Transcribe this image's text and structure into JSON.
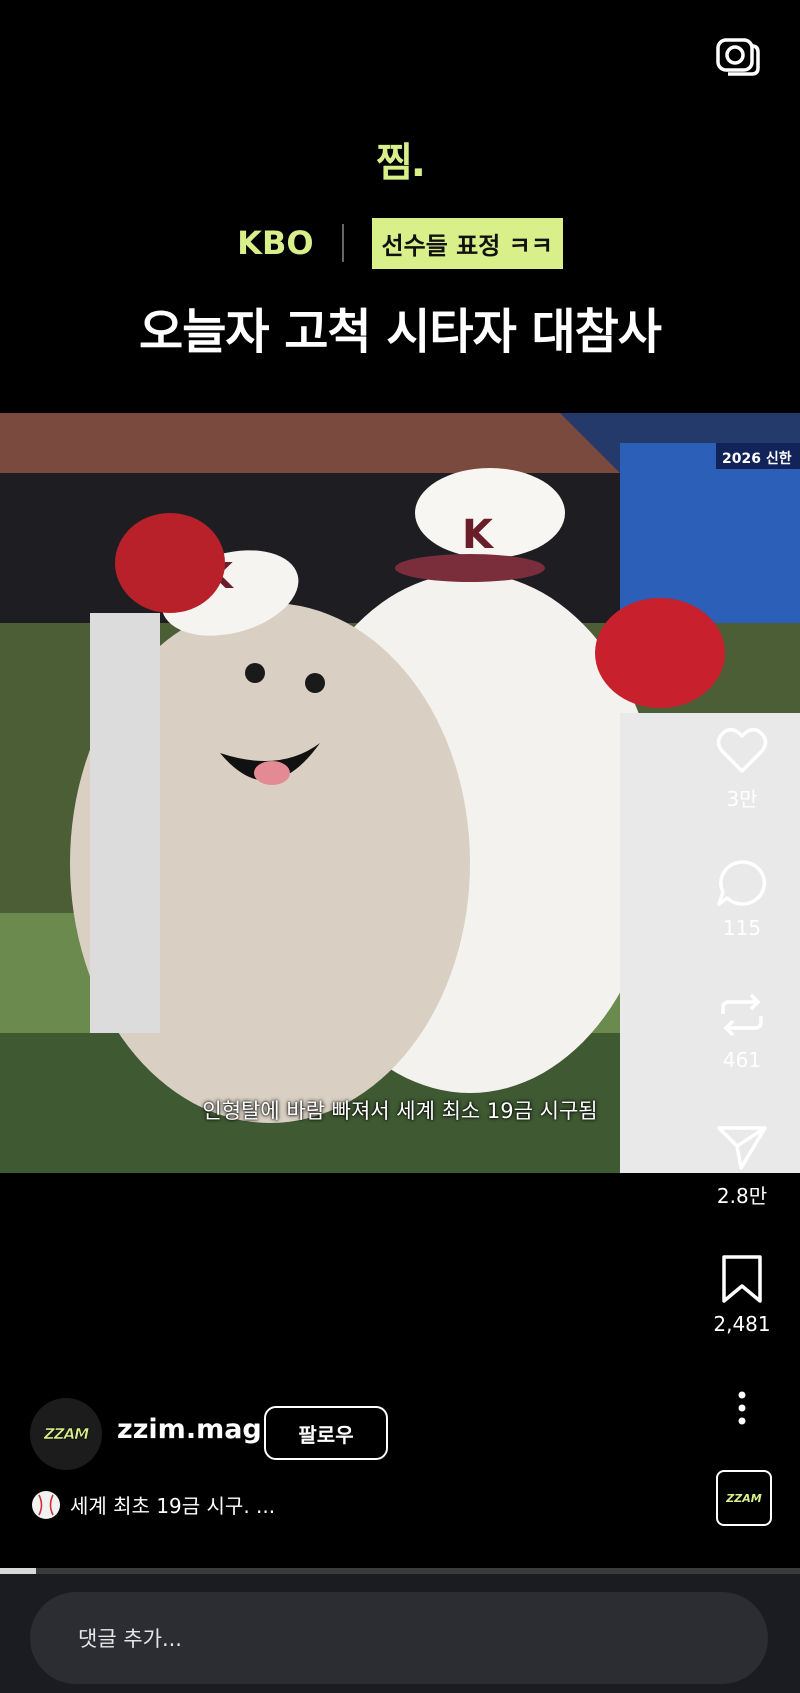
{
  "brand": {
    "logo_text": "찜."
  },
  "header": {
    "category": "KBO",
    "chip": "선수들 표정 ㅋㅋ",
    "headline": "오늘자 고척 시타자 대참사"
  },
  "video": {
    "scoreboard_text": "2026 신한",
    "subtitle": "인형탈에 바람 빠져서 세계 최소 19금 시구됨"
  },
  "actions": {
    "likes": "3만",
    "comments": "115",
    "reposts": "461",
    "shares": "2.8만",
    "saves": "2,481"
  },
  "author": {
    "avatar_text": "ZZAM",
    "username": "zzim.mag",
    "follow_label": "팔로우"
  },
  "caption": {
    "text": "세계 최초 19금 시구. ..."
  },
  "profile_thumb_text": "ZZAM",
  "progress": {
    "fraction": 0.045
  },
  "comment": {
    "placeholder": "댓글 추가..."
  },
  "colors": {
    "accent": "#d8ef8a",
    "background": "#000000"
  },
  "icons": [
    "camera-icon",
    "heart-icon",
    "comment-icon",
    "repost-icon",
    "send-icon",
    "bookmark-icon",
    "more-icon",
    "baseball-icon"
  ]
}
